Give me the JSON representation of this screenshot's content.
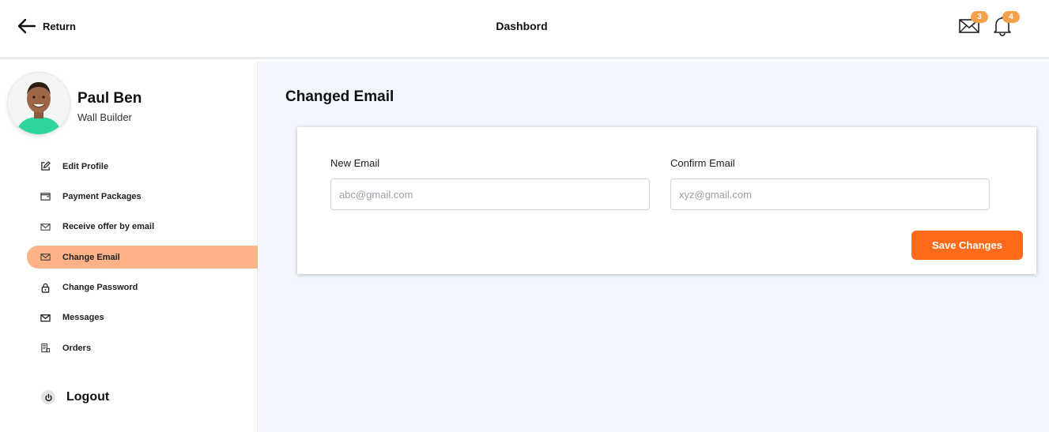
{
  "header": {
    "return_label": "Return",
    "title": "Dashbord",
    "mail_count": "3",
    "notification_count": "4"
  },
  "profile": {
    "name": "Paul Ben",
    "role": "Wall Builder"
  },
  "sidebar": {
    "items": [
      {
        "label": "Edit Profile",
        "icon": "edit-icon"
      },
      {
        "label": "Payment Packages",
        "icon": "wallet-icon"
      },
      {
        "label": "Receive offer by email",
        "icon": "mail-icon"
      },
      {
        "label": "Change Email",
        "icon": "mail-icon",
        "active": true
      },
      {
        "label": "Change Password",
        "icon": "lock-icon"
      },
      {
        "label": "Messages",
        "icon": "mail-icon"
      },
      {
        "label": "Orders",
        "icon": "receipt-icon"
      }
    ],
    "logout_label": "Logout"
  },
  "main": {
    "section_title": "Changed Email",
    "new_email_label": "New Email",
    "new_email_placeholder": "abc@gmail.com",
    "confirm_email_label": "Confirm Email",
    "confirm_email_placeholder": "xyz@gmail.com",
    "save_label": "Save Changes"
  },
  "colors": {
    "accent": "#ff6b1a",
    "active_item": "#ffb286",
    "badge": "#f5a04a",
    "main_bg": "#f1f6fd"
  }
}
